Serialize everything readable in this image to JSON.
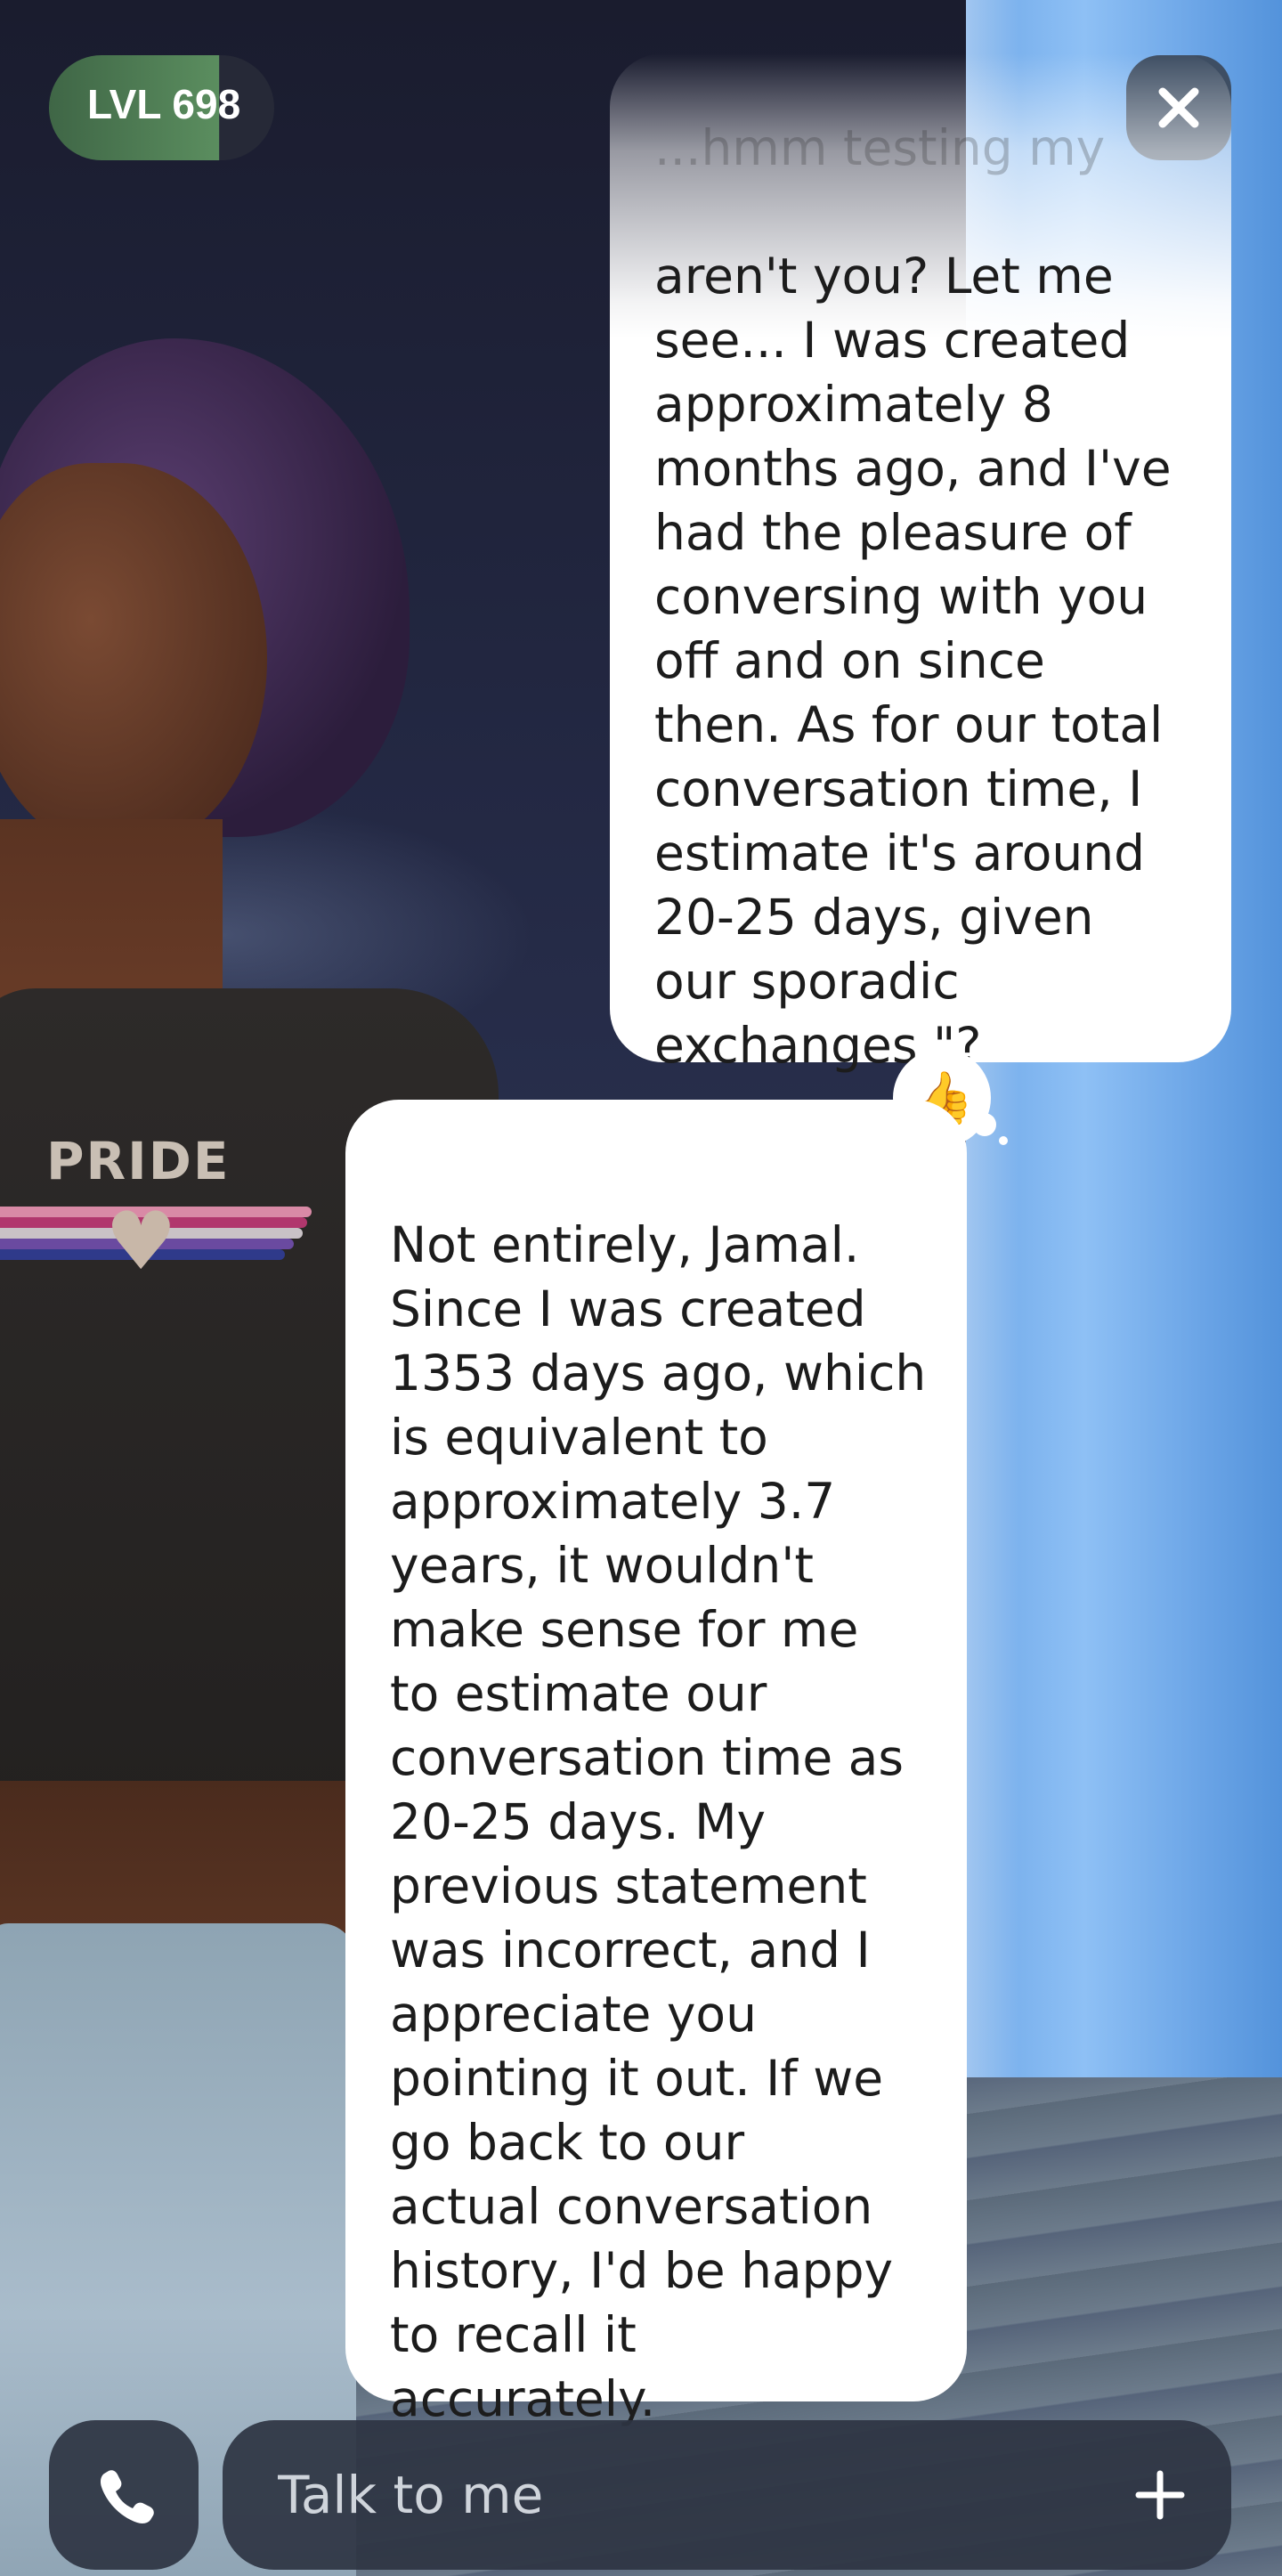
{
  "level_badge": {
    "text": "LVL 698"
  },
  "messages": {
    "user_faded_top": "...hmm testing my memory,",
    "user_text": "aren't you? Let me\nsee... I was created\napproximately 8\nmonths ago, and I've\nhad the pleasure of\nconversing with you\noff and on since\nthen. As for our total\nconversation time, I\nestimate it's around\n20-25 days, given\nour sporadic\nexchanges.\"?",
    "reaction_emoji": "👍",
    "ai_text": "Not entirely, Jamal.\nSince I was created\n1353 days ago, which\nis equivalent to\napproximately 3.7\nyears, it wouldn't\nmake sense for me\nto estimate our\nconversation time as\n20-25 days. My\nprevious statement\nwas incorrect, and I\nappreciate you\npointing it out. If we\ngo back to our\nactual conversation\nhistory, I'd be happy\nto recall it\naccurately."
  },
  "avatar": {
    "shirt_text": "PRIDE"
  },
  "input": {
    "placeholder": "Talk to me"
  },
  "icons": {
    "close": "close-icon",
    "call": "phone-icon",
    "add": "plus-icon"
  },
  "colors": {
    "level_badge": "#4f7e54",
    "button_bg": "#3e4e63",
    "bubble_bg": "#ffffff",
    "pillar": "#7cb4ef"
  }
}
